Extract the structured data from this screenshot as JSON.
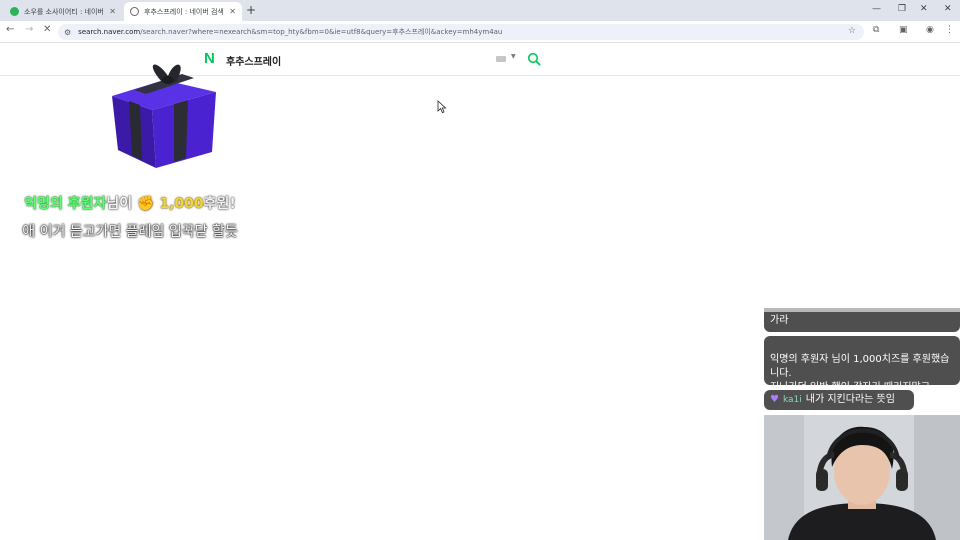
{
  "browser": {
    "tabs": [
      {
        "title": "소우를 소사이어티 : 네이버 카",
        "active": false
      },
      {
        "title": "후추스프레이 : 네이버 검색",
        "active": true
      }
    ],
    "new_tab_icon": "plus-icon",
    "url_host": "search.naver.com",
    "url_rest": "/search.naver?where=nexearch&sm=top_hty&fbm=0&ie=utf8&query=후추스프레이&ackey=mh4ym4au"
  },
  "naver": {
    "logo": "N",
    "query": "후추스프레이",
    "brand_color": "#03c75a"
  },
  "donation": {
    "donor": "익명의 후원자",
    "suffix1": "님이",
    "coin_icon": "coin-hand-icon",
    "amount": "1,000",
    "suffix2": "후원!",
    "message": "애 이거 듣고가면 플레임 입꾹닫 할듯"
  },
  "chat": {
    "messages": [
      {
        "text": "가라"
      },
      {
        "text": "익명의 후원자 님이 1,000치즈를 후원했습니다.\n지나가던 일반 행인 갑자기 때리지말고"
      },
      {
        "nickname": "ka1i",
        "text": "내가 지킨다라는 뜻임"
      }
    ]
  }
}
